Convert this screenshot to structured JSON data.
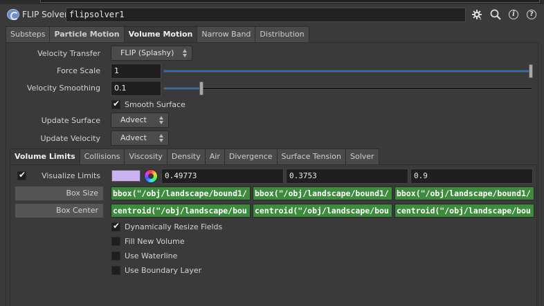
{
  "header": {
    "node_type": "FLIP Solver",
    "node_name": "flipsolver1",
    "icons": [
      "fluid-solver-icon",
      "gear-icon",
      "search-icon",
      "info-icon",
      "help-icon"
    ]
  },
  "tabs": [
    {
      "label": "Substeps",
      "active": false
    },
    {
      "label": "Particle Motion",
      "active": false
    },
    {
      "label": "Volume Motion",
      "active": true
    },
    {
      "label": "Narrow Band",
      "active": false
    },
    {
      "label": "Distribution",
      "active": false
    }
  ],
  "volume_motion": {
    "velocity_transfer": {
      "label": "Velocity Transfer",
      "value": "FLIP (Splashy)"
    },
    "force_scale": {
      "label": "Force Scale",
      "value": "1",
      "slider_fraction": 1.0
    },
    "velocity_smoothing": {
      "label": "Velocity Smoothing",
      "value": "0.1",
      "slider_fraction": 0.1
    },
    "smooth_surface": {
      "label": "Smooth Surface",
      "checked": true
    },
    "update_surface": {
      "label": "Update Surface",
      "value": "Advect"
    },
    "update_velocity": {
      "label": "Update Velocity",
      "value": "Advect"
    }
  },
  "subtabs": [
    {
      "label": "Volume Limits",
      "active": true
    },
    {
      "label": "Collisions",
      "active": false
    },
    {
      "label": "Viscosity",
      "active": false
    },
    {
      "label": "Density",
      "active": false
    },
    {
      "label": "Air",
      "active": false
    },
    {
      "label": "Divergence",
      "active": false
    },
    {
      "label": "Surface Tension",
      "active": false
    },
    {
      "label": "Solver",
      "active": false
    }
  ],
  "volume_limits": {
    "visualize_limits": {
      "label": "Visualize Limits",
      "checked": true,
      "color": "#c9b2ef",
      "values": [
        "0.49773",
        "0.3753",
        "0.9"
      ]
    },
    "box_size": {
      "label": "Box Size",
      "values": [
        "bbox(\"/obj/landscape/bound1/",
        "bbox(\"/obj/landscape/bound1/",
        "bbox(\"/obj/landscape/bound1/"
      ]
    },
    "box_center": {
      "label": "Box Center",
      "values": [
        "centroid(\"/obj/landscape/bou",
        "centroid(\"/obj/landscape/bou",
        "centroid(\"/obj/landscape/bou"
      ]
    },
    "dynamically_resize_fields": {
      "label": "Dynamically Resize Fields",
      "checked": true
    },
    "fill_new_volume": {
      "label": "Fill New Volume",
      "checked": false
    },
    "use_waterline": {
      "label": "Use Waterline",
      "checked": false
    },
    "use_boundary_layer": {
      "label": "Use Boundary Layer",
      "checked": false
    }
  },
  "colors": {
    "expression_green": "#3d8b3d",
    "slider_blue": "#2f6fb5",
    "background": "#3a3a3a"
  }
}
